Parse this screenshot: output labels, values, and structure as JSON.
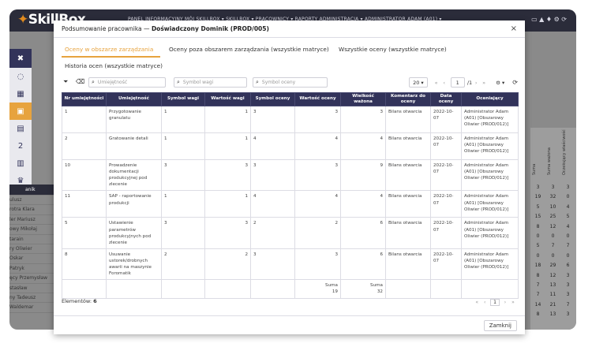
{
  "app": {
    "logo": "SkillBox",
    "topnav": "PANEL INFORMACYJNY   MÓJ SKILLBOX ▾   SKILLBOX ▾   PRACOWNICY ▾   RAPORTY   ADMINISTRACJA ▾   ADMINISTRATOR ADAM (A01) ▾",
    "names": [
      "anik",
      "ulusz",
      "rotra Klara",
      "ler Mariusz",
      "owy Mikołaj",
      "tarain",
      "ry Oliwier",
      "Oskar",
      "Patryk",
      "ęcy Przemysław",
      "stasław",
      "ny Tadeusz",
      "Waldemar"
    ],
    "right_cols": [
      "Suma",
      "Suma ważona",
      "Oczekujący właściwość"
    ],
    "right_nums": [
      [
        "3",
        "3",
        "3"
      ],
      [
        "19",
        "32",
        "0"
      ],
      [
        "5",
        "10",
        "4"
      ],
      [
        "15",
        "25",
        "5"
      ],
      [
        "8",
        "12",
        "4"
      ],
      [
        "0",
        "0",
        "0"
      ],
      [
        "5",
        "7",
        "7"
      ],
      [
        "0",
        "0",
        "0"
      ],
      [
        "18",
        "29",
        "6"
      ],
      [
        "8",
        "12",
        "3"
      ],
      [
        "7",
        "13",
        "3"
      ],
      [
        "7",
        "11",
        "3"
      ],
      [
        "14",
        "21",
        "7"
      ],
      [
        "8",
        "13",
        "3"
      ]
    ]
  },
  "modal": {
    "title_prefix": "Podsumowanie pracownika — ",
    "title_name": "Doświadczony Dominik (PROD/005)",
    "close_symbol": "×",
    "tabs": [
      {
        "label": "Oceny w obszarze zarządzania"
      },
      {
        "label": "Oceny poza obszarem zarządzania (wszystkie matryce)"
      },
      {
        "label": "Wszystkie oceny (wszystkie matryce)"
      },
      {
        "label": "Historia ocen (wszystkie matryce)"
      }
    ],
    "filters": {
      "skill_placeholder": "Umiejętność",
      "weight_placeholder": "Symbol wagi",
      "grade_placeholder": "Symbol oceny"
    },
    "pager": {
      "page_size": "20 ▾",
      "page": "1",
      "total": "/1"
    },
    "columns": [
      "Nr umiejętności",
      "Umiejętność",
      "Symbol wagi",
      "Wartość wagi",
      "Symbol oceny",
      "Wartość oceny",
      "Wielkość ważona",
      "Komentarz do oceny",
      "Data oceny",
      "Oceniający"
    ],
    "rows": [
      [
        "1",
        "Przygotowanie granulatu",
        "1",
        "1",
        "3",
        "3",
        "3",
        "Bilans otwarcia",
        "2022-10-07",
        "Administrator Adam (A01) [Obszarowy Oliwier (PROD/012)]"
      ],
      [
        "2",
        "Gratowanie detali",
        "1",
        "1",
        "4",
        "4",
        "4",
        "Bilans otwarcia",
        "2022-10-07",
        "Administrator Adam (A01) [Obszarowy Oliwier (PROD/012)]"
      ],
      [
        "10",
        "Prowadzenie dokumentacji produkcyjnej pod zlecenie",
        "3",
        "3",
        "3",
        "3",
        "9",
        "Bilans otwarcia",
        "2022-10-07",
        "Administrator Adam (A01) [Obszarowy Oliwier (PROD/012)]"
      ],
      [
        "11",
        "SAP - raportowanie produkcji",
        "1",
        "1",
        "4",
        "4",
        "4",
        "Bilans otwarcia",
        "2022-10-07",
        "Administrator Adam (A01) [Obszarowy Oliwier (PROD/012)]"
      ],
      [
        "5",
        "Ustawienie parametrów produkcyjnych pod zlecenie",
        "3",
        "3",
        "2",
        "2",
        "6",
        "Bilans otwarcia",
        "2022-10-07",
        "Administrator Adam (A01) [Obszarowy Oliwier (PROD/012)]"
      ],
      [
        "8",
        "Usuwanie ustorek/drobnych awarii na maszynie Foromatik",
        "2",
        "2",
        "3",
        "3",
        "6",
        "Bilans otwarcia",
        "2022-10-07",
        "Administrator Adam (A01) [Obszarowy Oliwier (PROD/012)]"
      ]
    ],
    "sum": {
      "label": "Suma",
      "grade_sum": "19",
      "weighted_sum": "32"
    },
    "elements_label": "Elementów:",
    "elements_count": "6",
    "bottom_page": "1",
    "close_button": "Zamknij"
  },
  "colors": {
    "accent": "#e7a33e",
    "header": "#32335a",
    "topbar": "#2b2c3a"
  }
}
